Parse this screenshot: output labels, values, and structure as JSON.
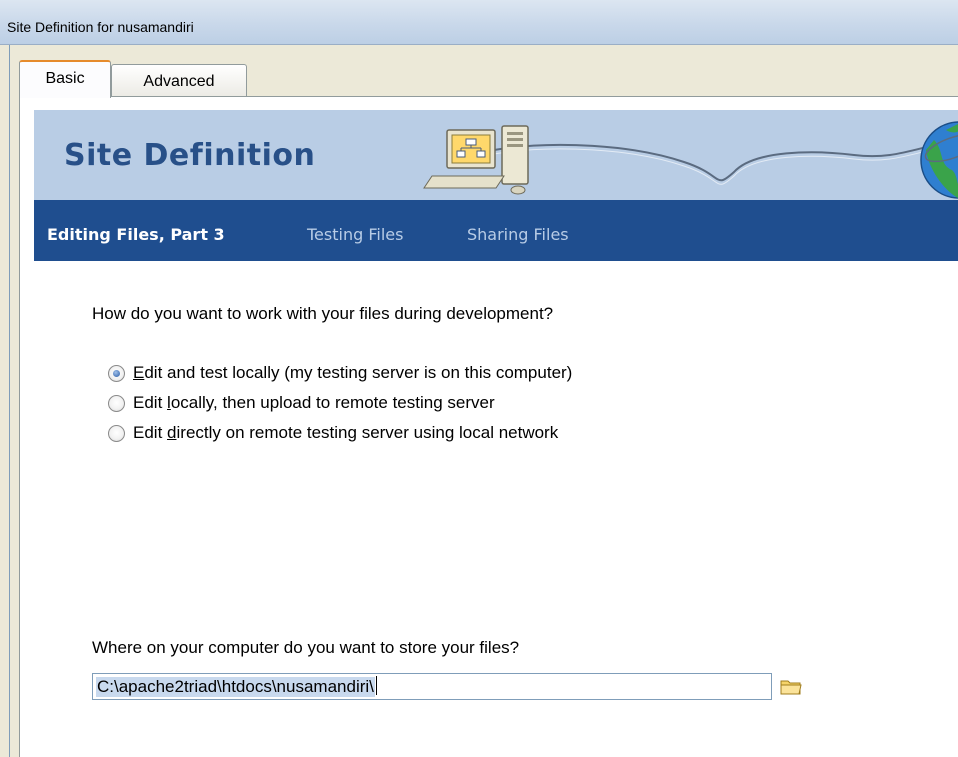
{
  "window": {
    "title": "Site Definition for nusamandiri"
  },
  "tabs": [
    {
      "label": "Basic",
      "active": true
    },
    {
      "label": "Advanced",
      "active": false
    }
  ],
  "banner": {
    "title": "Site Definition",
    "art_icons": [
      "computer-network-icon",
      "globe-icon"
    ]
  },
  "steps": {
    "current": "Editing Files, Part 3",
    "next": "Testing Files",
    "last": "Sharing Files"
  },
  "question": "How do you want to work with your files during development?",
  "options": [
    {
      "pre": "",
      "mnemonic": "E",
      "post": "dit and test locally (my testing server is on this computer)",
      "checked": true
    },
    {
      "pre": "Edit ",
      "mnemonic": "l",
      "post": "ocally, then upload to remote testing server",
      "checked": false
    },
    {
      "pre": "Edit ",
      "mnemonic": "d",
      "post": "irectly on remote testing server using local network",
      "checked": false
    }
  ],
  "storage": {
    "label": "Where on your computer do you want to store your files?",
    "value": "C:\\apache2triad\\htdocs\\nusamandiri\\",
    "browse_icon": "folder-icon"
  },
  "colors": {
    "banner_bg": "#b9cde5",
    "banner_title": "#285088",
    "stepnav_bg": "#1f4e8f",
    "step_inactive": "#b8cce6"
  }
}
